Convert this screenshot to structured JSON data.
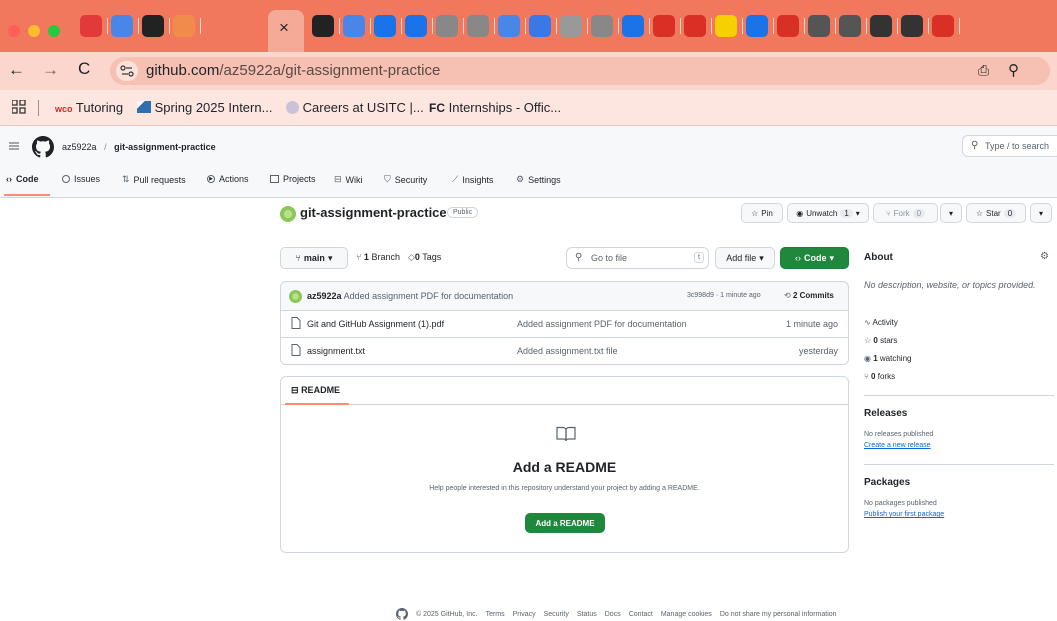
{
  "browser": {
    "url_domain": "github.com",
    "url_path": "/az5922a/git-assignment-practice",
    "close_glyph": "×",
    "tab_colors": [
      "#e23a3a",
      "#4a86e8",
      "#222222",
      "#f08b4a",
      "#222222",
      "#4a86e8",
      "#1a73e8",
      "#1a73e8",
      "#888888",
      "#888888",
      "#4a86e8",
      "#3b78e7",
      "#999999",
      "#888888",
      "#1a73e8",
      "#d93025",
      "#d93025",
      "#f6d000",
      "#1a73e8",
      "#d93025",
      "#555555",
      "#555555",
      "#333333",
      "#333333",
      "#d93025"
    ],
    "bookmarks": [
      {
        "icon_text": "wco",
        "label": "Tutoring"
      },
      {
        "label": "Spring 2025 Intern..."
      },
      {
        "label": "Careers at USITC |..."
      },
      {
        "icon_text": "FC",
        "label": "Internships - Offic..."
      }
    ]
  },
  "header": {
    "owner": "az5922a",
    "separator": "/",
    "repo": "git-assignment-practice",
    "search_placeholder": "Type / to search",
    "search_key": "/",
    "nav": [
      {
        "label": "Code",
        "icon": "code-icon"
      },
      {
        "label": "Issues",
        "icon": "issue-icon"
      },
      {
        "label": "Pull requests",
        "icon": "pull-request-icon"
      },
      {
        "label": "Actions",
        "icon": "play-icon"
      },
      {
        "label": "Projects",
        "icon": "table-icon"
      },
      {
        "label": "Wiki",
        "icon": "book-icon"
      },
      {
        "label": "Security",
        "icon": "shield-icon"
      },
      {
        "label": "Insights",
        "icon": "graph-icon"
      },
      {
        "label": "Settings",
        "icon": "gear-icon"
      }
    ]
  },
  "repo": {
    "name": "git-assignment-practice",
    "visibility": "Public",
    "pin_label": "Pin",
    "unwatch_label": "Unwatch",
    "watch_count": "1",
    "fork_label": "Fork",
    "fork_count": "0",
    "star_label": "Star",
    "star_count": "0"
  },
  "toolbar": {
    "branch": "main",
    "branches_count": "1",
    "branches_label": "Branch",
    "tags_count": "0",
    "tags_label": "Tags",
    "goto_placeholder": "Go to file",
    "goto_key": "t",
    "add_file_label": "Add file",
    "code_label": "Code"
  },
  "commit": {
    "author": "az5922a",
    "message": "Added assignment PDF for documentation",
    "hash": "3c998d9",
    "dot": "·",
    "time": "1 minute ago",
    "count_label": "2 Commits"
  },
  "files": [
    {
      "name": "Git and GitHub Assignment (1).pdf",
      "message": "Added assignment PDF for documentation",
      "time": "1 minute ago"
    },
    {
      "name": "assignment.txt",
      "message": "Added assignment.txt file",
      "time": "yesterday"
    }
  ],
  "readme": {
    "tab_label": "README",
    "title": "Add a README",
    "description": "Help people interested in this repository understand your project by adding a README.",
    "button_label": "Add a README"
  },
  "about": {
    "title": "About",
    "description": "No description, website, or topics provided.",
    "activity": "Activity",
    "stars_count": "0",
    "stars_label": "stars",
    "watching_count": "1",
    "watching_label": "watching",
    "forks_count": "0",
    "forks_label": "forks"
  },
  "releases": {
    "title": "Releases",
    "none_text": "No releases published",
    "link": "Create a new release"
  },
  "packages": {
    "title": "Packages",
    "none_text": "No packages published",
    "link": "Publish your first package"
  },
  "footer": {
    "copyright": "© 2025 GitHub, Inc.",
    "links": [
      "Terms",
      "Privacy",
      "Security",
      "Status",
      "Docs",
      "Contact",
      "Manage cookies",
      "Do not share my personal information"
    ]
  },
  "colors": {
    "tabstrip": "#f1785c",
    "addressbar": "#fbd6cc",
    "green": "#1f883d",
    "link": "#0969da",
    "border": "#d0d7de",
    "nav_underline": "#fd8c73"
  }
}
